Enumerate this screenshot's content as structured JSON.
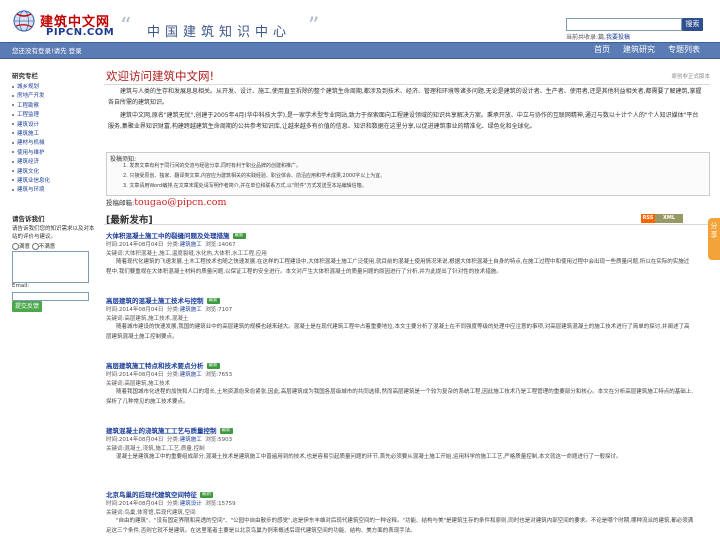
{
  "header": {
    "logo_cn": "建筑中文网",
    "logo_en": "PIPCN.COM",
    "slogan": "中国建筑知识中心",
    "search": {
      "placeholder": "",
      "button_label": "搜索"
    },
    "search_hint_prefix": "当前共收录:篇,",
    "search_hint_link": "我要投稿"
  },
  "navbar": {
    "welcome": "您还没有登录!请先 登录",
    "links": [
      "首页",
      "建筑研究",
      "专题列表"
    ]
  },
  "sidebar": {
    "research_title": "研究专栏",
    "research_items": [
      "城乡规划",
      "房地产开发",
      "工程勘察",
      "工程监理",
      "建筑设计",
      "建筑施工",
      "建材与机械",
      "使用与维护",
      "建筑经济",
      "建筑文化",
      "建筑业信息化",
      "建筑与环境"
    ],
    "feedback": {
      "title": "请告诉我们",
      "prompt": "请告诉我们您的知识需求以及对本站的评价与建议。",
      "radio_labels": [
        "满意",
        "不满意"
      ],
      "email_label": "Email:",
      "submit_label": "提交反馈"
    }
  },
  "main": {
    "welcome_title": "欢迎访问建筑中文网!",
    "original_note": "原创非正式版本",
    "para1": "建筑与人类的生存和发展息息相关。从开发、设计、施工,使用直至拆除的整个建筑生命周期,都涉及到技术、经济、管理和环境等诸多问题,无论是建筑的设计者、生产者、使用者,还是其他利益相关者,都需要了解建筑,掌握各自所需的建筑知识。",
    "para2": "建筑中文网,原名\"建筑无忧\",创建于2005年4月(华中科技大学),是一家学术型专业网站,致力于探索面向工程建设领域的知识共享解决方案。秉承开放、中立与协作的互联网精神,通过与数以十计个人的\"个人知识媒体\"平台服务,集聚业界知识财富,构建跨越建筑生命周期的公共参考知识库,让越来越多有价值的信息、知识和数据在这里分享,以促进建筑事业的精准化、绿色化和全球化。",
    "tips": {
      "heading": "投稿须知:",
      "items": [
        "1. 发表文章有利于同行间的交流与经验分享,同时有利于职业品牌的创建和推广。",
        "2. 只接受原创、独家、翻译类文章,内容应为建筑相关的实践经验、职业体会、前沿应用和学术成果,2000字以上为宜。",
        "3. 文章请用Word编排,在文章末尾处请写明作者简介,并在单位和联系方式,以\"附件\"方式发送至本站编辑信箱。"
      ],
      "email_label": "投稿邮箱:",
      "email_value": "tougao@pipcn.com"
    },
    "latest_title": "[最新发布]",
    "rss_left": "RSS",
    "rss_right": "XML",
    "article_meta_labels": {
      "time": "时间:",
      "category": "分类:",
      "views": "浏览:",
      "keywords": "关键词:"
    },
    "articles": [
      {
        "title": "大体积混凝土施工中的裂缝问题及处理措施",
        "badge": "最新",
        "time": "2014年08月04日",
        "category": "建筑施工",
        "views": "14067",
        "keywords": "大体积混凝土,施工,温度裂缝,水化热,大体积,水工工程,应用",
        "summary": "随着现代化建筑的飞速发展,土木工程技术也随之快速发展,在这样的工程建设中,大体积混凝土施工广泛使用,就目前的混凝土使用情况来说,根据大体积混凝土自身的特点,在施工过程中和使用过程中会出现一些质量问题,所以在实际的实施过程中,我们要重视在大体积混凝土材料的质量问题,以保证工程的安全进行。本文对产生大体积混凝土的质量问题的原因进行了分析,并为此提出了针对性的技术措施。"
      },
      {
        "title": "高层建筑的混凝土施工技术与控制",
        "badge": "最新",
        "time": "2014年08月04日",
        "category": "建筑施工",
        "views": "7107",
        "keywords": "高层建筑,施工技术,混凝土",
        "summary": "随着城市建设的快速发展,我国的建筑业中的高层建筑的规模也越来越大。混凝土是在现代建筑工程中占着重要地位,本文主要分析了混凝土在不同强度等级的处理中应注意的事项,对高层建筑混凝土的施工技术进行了简单的探讨,并阐述了高层建筑混凝土施工控制要点。"
      },
      {
        "title": "高层建筑施工特点和技术要点分析",
        "badge": "最新",
        "time": "2014年08月04日",
        "category": "建筑施工",
        "views": "7653",
        "keywords": "高层建筑,施工技术",
        "summary": "随着我国城市化进程的加快和人口的增长,土地资源愈来愈紧张,因此,高层建筑成为我国各层级城市的共同选择,然而高层建筑是一个较为复杂的系统工程,因此施工技术乃是工程管理的重要部分和核心。本文在分析高层建筑施工特点的基础上,探析了几种常见的施工技术要点。"
      },
      {
        "title": "建筑混凝土的浇筑施工工艺与质量控制",
        "badge": "最新",
        "time": "2014年08月04日",
        "category": "建筑施工",
        "views": "5903",
        "keywords": "混凝土,浇筑,施工,工艺,质量,控制",
        "summary": "混凝土是建筑施工中的重要组成部分,混凝土技术是建筑施工中普遍用到的技术,也是容易引起质量问题的环节,首先必须要从混凝土施工开始,运用科学的施工工艺,严格质量控制,本文就这一命题进行了一般探讨。"
      },
      {
        "title": "北京鸟巢的后现代建筑空间特征",
        "badge": "最新",
        "time": "2014年08月04日",
        "category": "建筑设计",
        "views": "15759",
        "keywords": "鸟巢,体育馆,后现代建筑,空间",
        "summary": "\"自由的建筑\"、\"没有固定界限和亮透的空间\"、\"公园中自由散步的感觉\",这是伊东丰雄对后现代建筑空间的一种诠释。\"功能、结构与美\"是建筑生存的条件和原则,同时也是对建筑内部空间的要求。不论是哪个时期,哪种流派的建筑,都必须满足这三个条件,否则它就不是建筑。在这里笔者主要是以北京鸟巢为例来概述后现代建筑空间的功能、结构、美方面的表现手法。"
      }
    ]
  },
  "side_tab": "分享"
}
